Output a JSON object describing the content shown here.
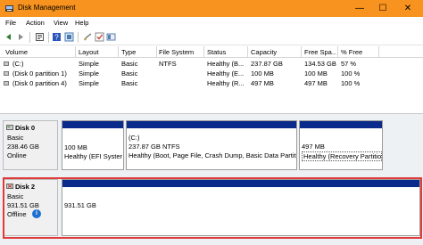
{
  "window": {
    "title": "Disk Management",
    "minimize_glyph": "—",
    "maximize_glyph": "☐",
    "close_glyph": "✕",
    "accent_color": "#f7931e"
  },
  "menu": [
    "File",
    "Action",
    "View",
    "Help"
  ],
  "toolbar": {
    "icons": [
      "back-icon",
      "forward-icon",
      "properties-icon",
      "help-icon",
      "refresh-icon",
      "connect-icon",
      "checkmark-icon",
      "view-icon"
    ]
  },
  "volume_list": {
    "columns": [
      "Volume",
      "Layout",
      "Type",
      "File System",
      "Status",
      "Capacity",
      "Free Spa...",
      "% Free"
    ],
    "rows": [
      [
        "(C:)",
        "Simple",
        "Basic",
        "NTFS",
        "Healthy (B...",
        "237.87 GB",
        "134.53 GB",
        "57 %"
      ],
      [
        "(Disk 0 partition 1)",
        "Simple",
        "Basic",
        "",
        "Healthy (E...",
        "100 MB",
        "100 MB",
        "100 %"
      ],
      [
        "(Disk 0 partition 4)",
        "Simple",
        "Basic",
        "",
        "Healthy (R...",
        "497 MB",
        "497 MB",
        "100 %"
      ]
    ]
  },
  "disks": [
    {
      "name": "Disk 0",
      "type": "Basic",
      "size": "238.46 GB",
      "status": "Online",
      "partitions": [
        {
          "line1": "100 MB",
          "line2": "Healthy (EFI Syster"
        },
        {
          "line0": "(C:)",
          "line1": "237.87 GB NTFS",
          "line2": "Healthy (Boot, Page File, Crash Dump, Basic Data Partiti"
        },
        {
          "line1": "497 MB",
          "line2": "Healthy (Recovery Partition)"
        }
      ]
    },
    {
      "name": "Disk 2",
      "type": "Basic",
      "size": "931.51 GB",
      "status": "Offline",
      "info_glyph": "i",
      "partitions": [
        {
          "line1": "931.51 GB"
        }
      ]
    }
  ],
  "colors": {
    "partition_bar": "#0a2a8c",
    "highlight_border": "#e03a3a",
    "info_blue": "#1d6fd1"
  }
}
